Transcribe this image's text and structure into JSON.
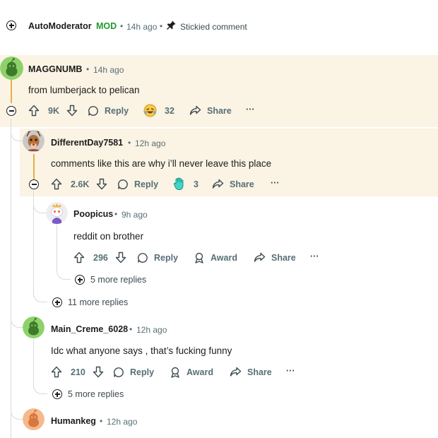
{
  "sticky": {
    "username": "AutoModerator",
    "badge": "MOD",
    "time": "14h ago",
    "label": "Stickied comment"
  },
  "comments": [
    {
      "username": "MAGGNUMB",
      "time": "14h ago",
      "body": "from lumberjack to pelican",
      "upvotes": "9K",
      "reply_label": "Reply",
      "award_count": "32",
      "share_label": "Share",
      "more_label": "···"
    },
    {
      "username": "DifferentDay7581",
      "time": "12h ago",
      "body": "comments like this are why i’ll never leave this place",
      "upvotes": "2.6K",
      "reply_label": "Reply",
      "award_count": "3",
      "share_label": "Share",
      "more_label": "···"
    },
    {
      "username": "Poopicus",
      "time": "9h ago",
      "body": "reddit on brother",
      "upvotes": "296",
      "reply_label": "Reply",
      "award_label": "Award",
      "share_label": "Share",
      "more_label": "···",
      "more_replies": "5 more replies"
    },
    {
      "username": "Main_Creme_6028",
      "time": "12h ago",
      "body": "Idc what anyone says , that’s fucking funny",
      "upvotes": "210",
      "reply_label": "Reply",
      "award_label": "Award",
      "share_label": "Share",
      "more_label": "···",
      "more_replies": "5 more replies"
    },
    {
      "username": "Humankeg",
      "time": "12h ago"
    }
  ],
  "thread_more_replies": "11 more replies",
  "separator": "•",
  "colors": {
    "highlight": "#fbf3e4",
    "gold_line": "#e2b04a",
    "thread_line": "#d7dadc",
    "mod_green": "#1f9a2f",
    "meta_gray": "#576f76"
  }
}
